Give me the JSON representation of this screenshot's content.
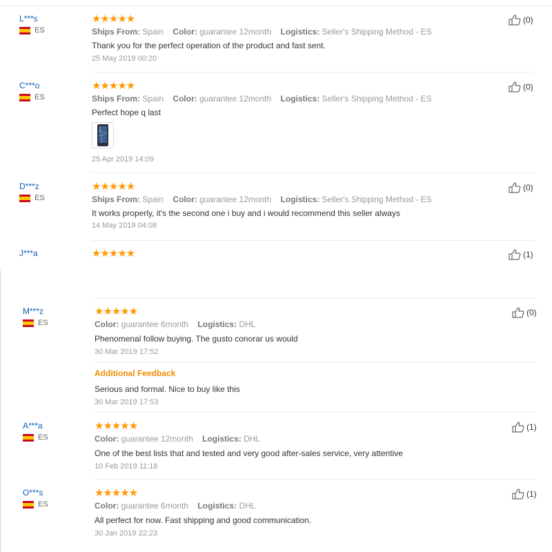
{
  "reviews_top": [
    {
      "user": "L***s",
      "country": "ES",
      "stars": "★★★★★",
      "ships_from_label": "Ships From:",
      "ships_from": "Spain",
      "color_label": "Color:",
      "color": "guarantee 12month",
      "logistics_label": "Logistics:",
      "logistics": "Seller's Shipping Method - ES",
      "text": "Thank you for the perfect operation of the product and fast sent.",
      "date": "25 May 2019 00:20",
      "likes": "(0)"
    },
    {
      "user": "C***o",
      "country": "ES",
      "stars": "★★★★★",
      "ships_from_label": "Ships From:",
      "ships_from": "Spain",
      "color_label": "Color:",
      "color": "guarantee 12month",
      "logistics_label": "Logistics:",
      "logistics": "Seller's Shipping Method - ES",
      "text": "Perfect hope q last",
      "date": "25 Apr 2019 14:09",
      "likes": "(0)"
    },
    {
      "user": "D***z",
      "country": "ES",
      "stars": "★★★★★",
      "ships_from_label": "Ships From:",
      "ships_from": "Spain",
      "color_label": "Color:",
      "color": "guarantee 12month",
      "logistics_label": "Logistics:",
      "logistics": "Seller's Shipping Method - ES",
      "text": "It works properly, it's the second one i buy and i would recommend this seller always",
      "date": "14 May 2019 04:08",
      "likes": "(0)"
    },
    {
      "user": "J***a",
      "stars": "★★★★★",
      "likes": "(1)"
    }
  ],
  "reviews_bottom": [
    {
      "user": "M***z",
      "country": "ES",
      "stars": "★★★★★",
      "color_label": "Color:",
      "color": "guarantee 6month",
      "logistics_label": "Logistics:",
      "logistics": "DHL",
      "text": "Phenomenal follow buying. The gusto conorar us would",
      "date": "30 Mar 2019 17:52",
      "likes": "(0)",
      "additional_title": "Additional Feedback",
      "additional_text": "Serious and formal. Nice to buy like this",
      "additional_date": "30 Mar 2019 17:53"
    },
    {
      "user": "A***a",
      "country": "ES",
      "stars": "★★★★★",
      "color_label": "Color:",
      "color": "guarantee 12month",
      "logistics_label": "Logistics:",
      "logistics": "DHL",
      "text": "One of the best lists that and tested and very good after-sales service, very attentive",
      "date": "10 Feb 2019 11:18",
      "likes": "(1)"
    },
    {
      "user": "O***s",
      "country": "ES",
      "stars": "★★★★★",
      "color_label": "Color:",
      "color": "guarantee 6month",
      "logistics_label": "Logistics:",
      "logistics": "DHL",
      "text": "All perfect for now. Fast shipping and good communication.",
      "date": "30 Jan 2019 22:23",
      "likes": "(1)"
    }
  ],
  "icons": {
    "like": "thumbs-up-icon",
    "flag": "spain-flag-icon"
  },
  "colors": {
    "star": "#ff9900",
    "username": "#0a5eb0",
    "additional_feedback": "#f08c00"
  }
}
